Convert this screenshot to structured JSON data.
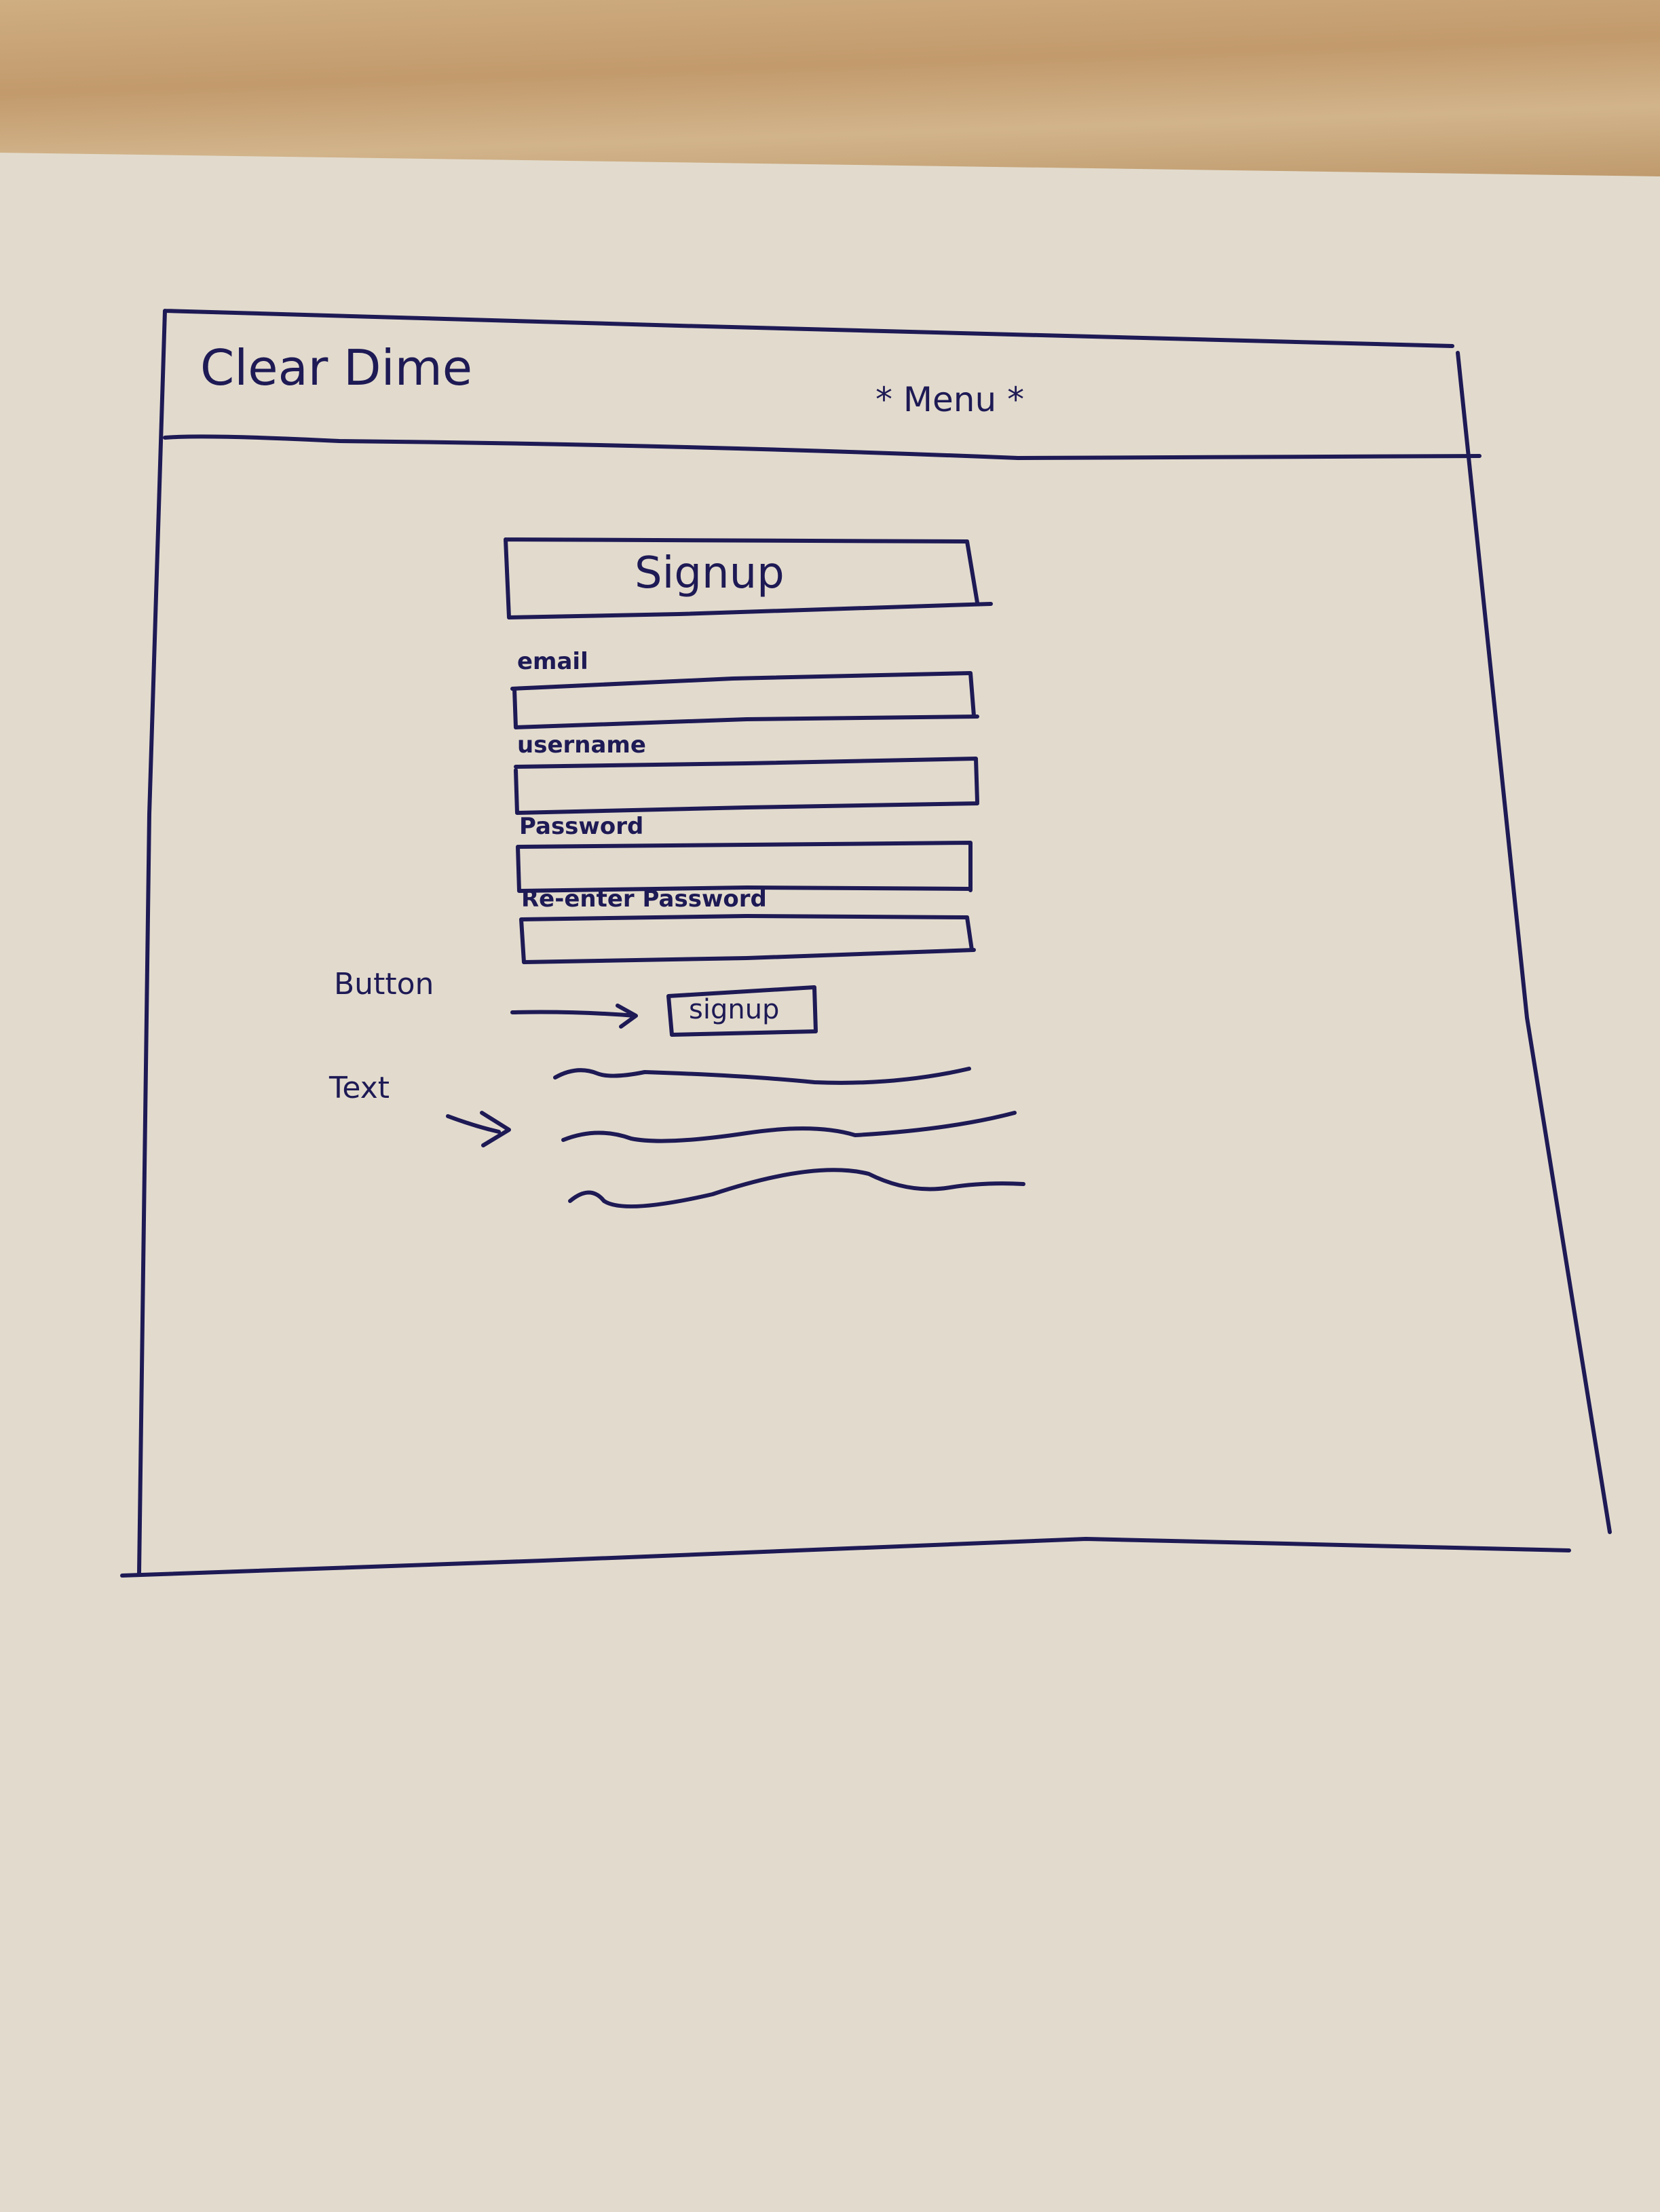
{
  "header": {
    "title": "Clear Dime",
    "menu_label": "* Menu *"
  },
  "form": {
    "title": "Signup",
    "fields": [
      {
        "label": "email"
      },
      {
        "label": "username"
      },
      {
        "label": "Password"
      },
      {
        "label": "Re-enter Password"
      }
    ],
    "submit_label": "signup"
  },
  "annotations": {
    "button_note": "Button",
    "text_note": "Text"
  },
  "colors": {
    "ink": "#1e1a55",
    "paper": "#e4ddd0",
    "desk": "#c9a576"
  }
}
